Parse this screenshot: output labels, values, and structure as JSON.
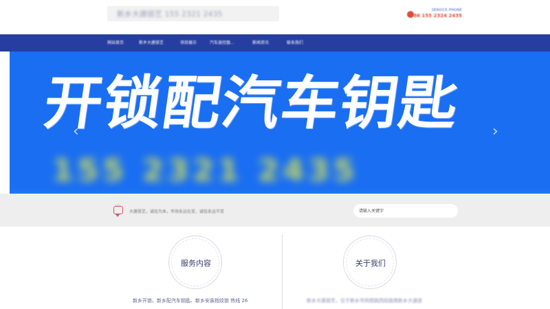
{
  "header": {
    "logo_text": "新乡大唐锁艺  155 2321 2435",
    "service_label": "SERVICE PHONE",
    "service_phone": "+86 155 2324 2435"
  },
  "nav": {
    "items": [
      "网站首页",
      "新乡大唐锁艺",
      "项目展示",
      "汽车遥控器...",
      "新闻资讯",
      "联系我们"
    ]
  },
  "banner": {
    "title": "开锁配汽车钥匙",
    "phone": "155 2321 2435",
    "prev_arrow": "‹",
    "next_arrow": "›"
  },
  "strip": {
    "notice": "大唐锁艺，诚信为本，市场永远在变，诚信永远不变",
    "search_placeholder": "请输入关键字"
  },
  "sections": {
    "services": {
      "title": "服务内容",
      "description": "新乡开锁、新乡配汽车钥匙、新乡安装指纹锁 热线 26"
    },
    "about": {
      "title": "关于我们",
      "description": "新乡大唐锁艺，位于新乡市同德路西段路南新乡大通道"
    }
  }
}
